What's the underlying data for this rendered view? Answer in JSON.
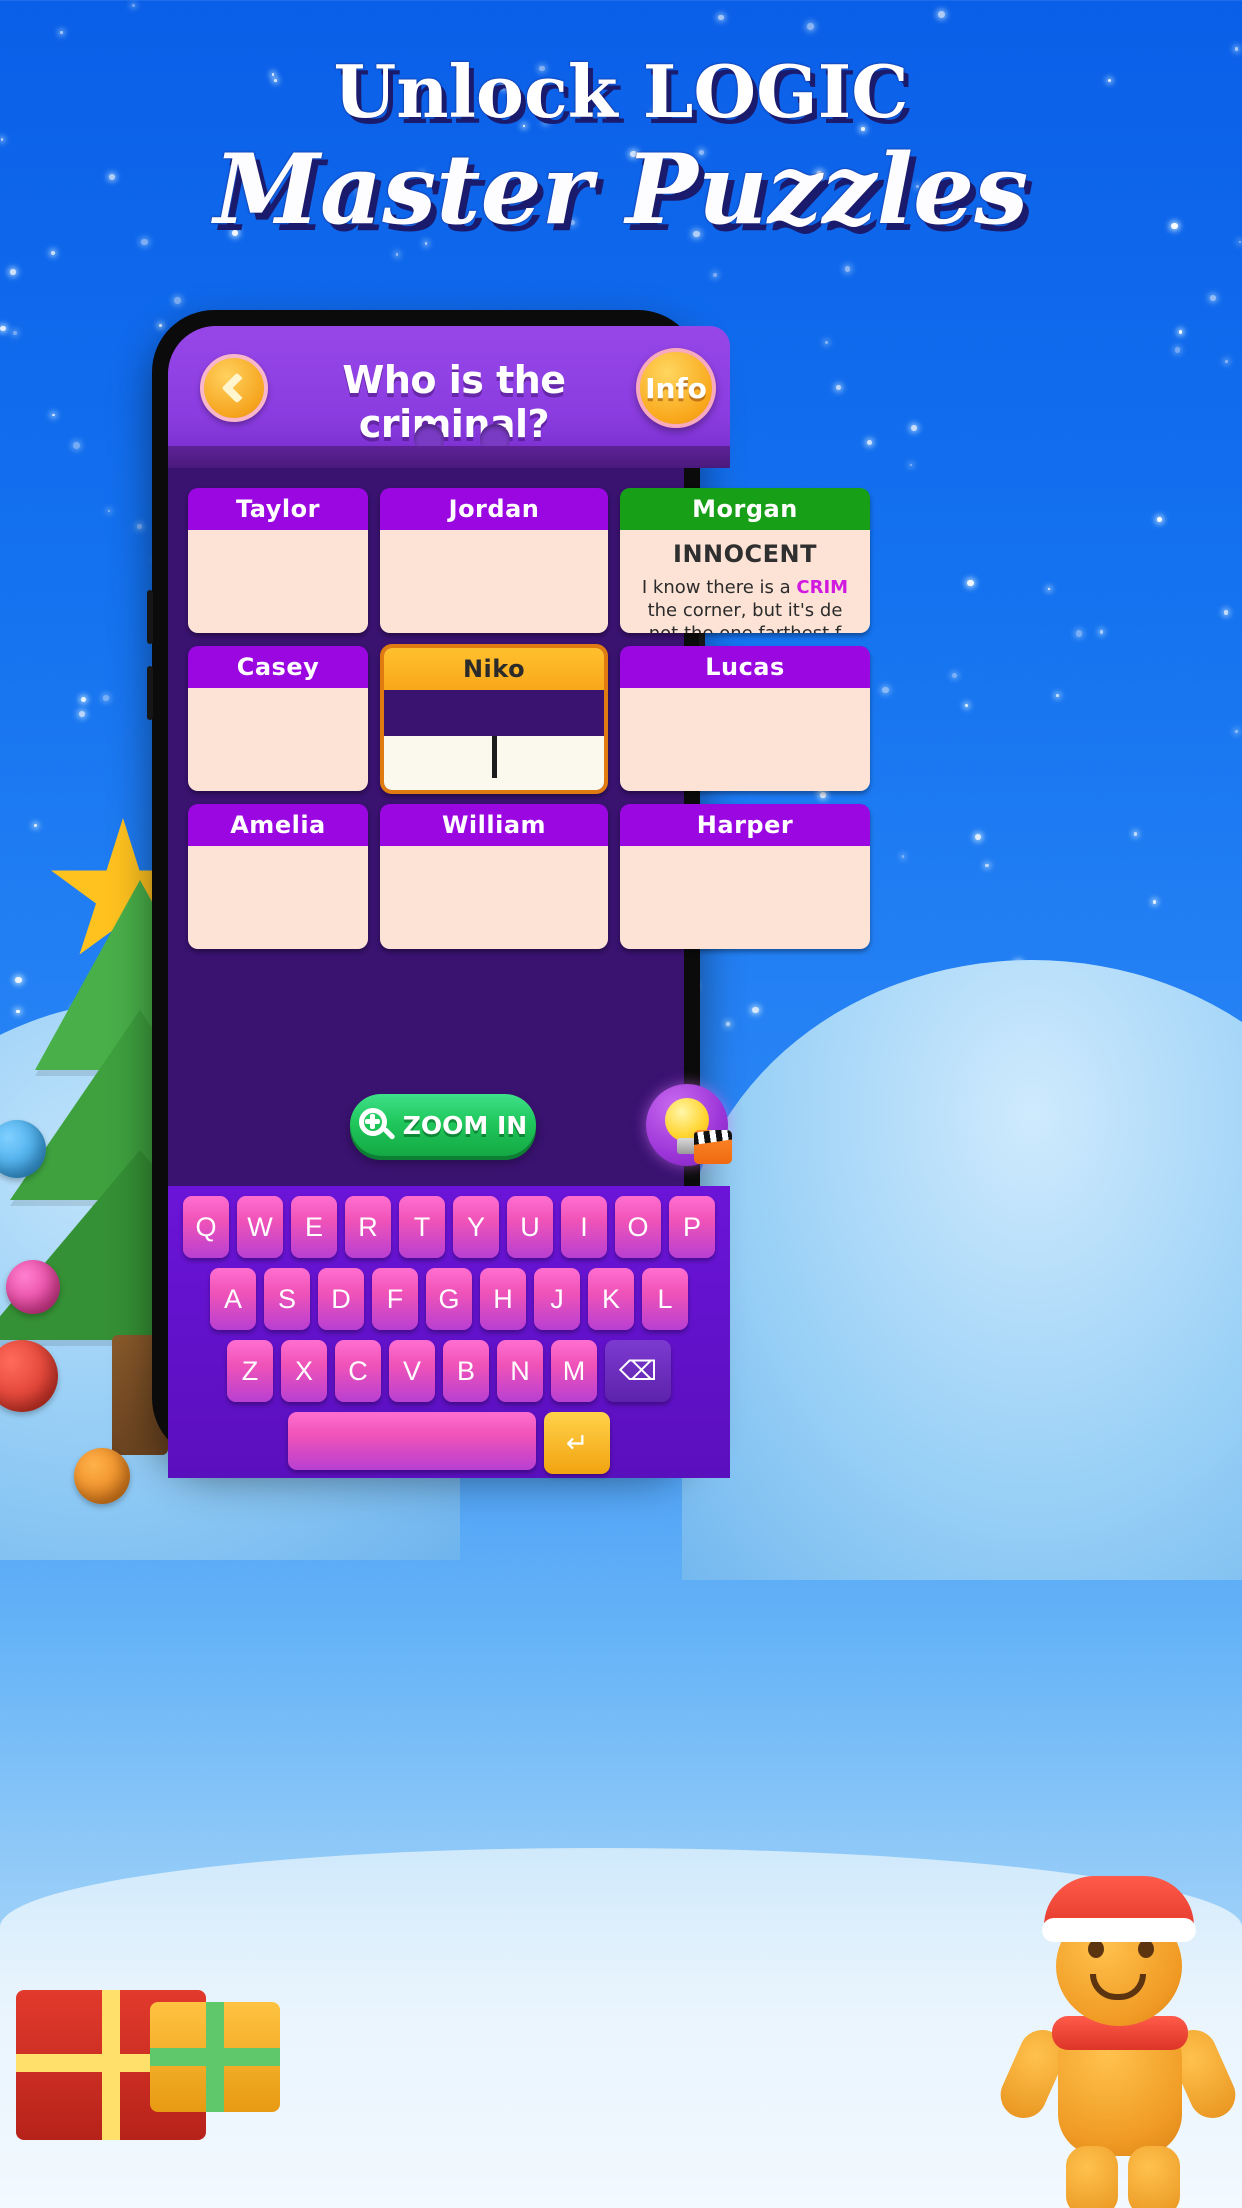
{
  "promo": {
    "line1": "Unlock LOGIC",
    "line2": "Master Puzzles"
  },
  "colors": {
    "background_blue": "#1573f0",
    "header_purple": "#8b3ce0",
    "board_purple": "#3a1270",
    "card_header_purple": "#9b07e0",
    "card_header_green": "#17a017",
    "card_header_amber": "#f8a81a",
    "card_body_cream": "#fce3d6",
    "zoom_button_green": "#20c85c",
    "key_pink": "#f053b8",
    "accent_orange": "#f6a51f",
    "criminal_magenta": "#d219e0"
  },
  "game": {
    "header": {
      "title": "Who is the criminal?",
      "back_icon": "chevron-left-icon",
      "info_label": "Info"
    },
    "board": {
      "cards": [
        {
          "name": "Taylor",
          "state": "empty",
          "verdict": "",
          "clue": ""
        },
        {
          "name": "Jordan",
          "state": "empty",
          "verdict": "",
          "clue": ""
        },
        {
          "name": "Morgan",
          "state": "solved",
          "verdict": "INNOCENT",
          "clue_parts": [
            "I know there is a ",
            "CRIM",
            "the corner, but it's de",
            "not the one farthest f"
          ]
        },
        {
          "name": "Casey",
          "state": "empty",
          "verdict": "",
          "clue": ""
        },
        {
          "name": "Niko",
          "state": "active",
          "verdict": "",
          "clue": ""
        },
        {
          "name": "Lucas",
          "state": "empty",
          "verdict": "",
          "clue": ""
        },
        {
          "name": "Amelia",
          "state": "empty",
          "verdict": "",
          "clue": ""
        },
        {
          "name": "William",
          "state": "empty",
          "verdict": "",
          "clue": ""
        },
        {
          "name": "Harper",
          "state": "empty",
          "verdict": "",
          "clue": ""
        }
      ]
    },
    "controls": {
      "zoom_label": "ZOOM IN",
      "zoom_icon": "magnifier-plus-icon",
      "hint_icon": "lightbulb-icon",
      "hint_badge_icon": "video-clapperboard-icon"
    },
    "keyboard": {
      "row1": [
        "Q",
        "W",
        "E",
        "R",
        "T",
        "Y",
        "U",
        "I",
        "O",
        "P"
      ],
      "row2": [
        "A",
        "S",
        "D",
        "F",
        "G",
        "H",
        "J",
        "K",
        "L"
      ],
      "row3": [
        "Z",
        "X",
        "C",
        "V",
        "B",
        "N",
        "M"
      ],
      "backspace_icon": "backspace-icon",
      "backspace_glyph": "⌫",
      "enter_icon": "enter-arrow-icon",
      "enter_glyph": "↵",
      "space_label": ""
    }
  }
}
